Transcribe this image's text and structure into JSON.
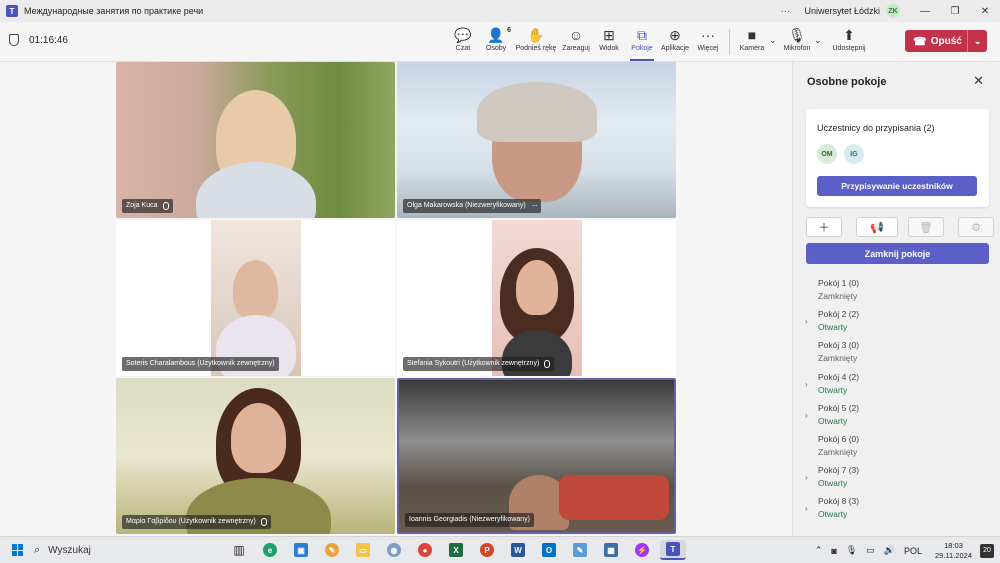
{
  "window": {
    "title": "Международные занятия по практике речи",
    "org": "Uniwersytet Łódzki",
    "user_initials": "ZK"
  },
  "meeting": {
    "timer": "01:16:46",
    "people_count": "6",
    "tools": [
      {
        "label": "Czat",
        "icon": "chat-icon"
      },
      {
        "label": "Osoby",
        "icon": "people-icon"
      },
      {
        "label": "Podnieś rękę",
        "icon": "raise-hand-icon"
      },
      {
        "label": "Zareaguj",
        "icon": "react-icon"
      },
      {
        "label": "Widok",
        "icon": "view-icon"
      },
      {
        "label": "Pokoje",
        "icon": "rooms-icon"
      },
      {
        "label": "Aplikacje",
        "icon": "apps-icon"
      },
      {
        "label": "Więcej",
        "icon": "more-icon"
      },
      {
        "label": "Kamera",
        "icon": "camera-icon"
      },
      {
        "label": "Mikrofon",
        "icon": "microphone-off-icon"
      },
      {
        "label": "Udostępnij",
        "icon": "share-icon"
      }
    ],
    "leave_label": "Opuść"
  },
  "participants": [
    {
      "name": "Zoja Kuca"
    },
    {
      "name": "Olga Makarowska (Niezweryfikowany)"
    },
    {
      "name": "Soteris Charalambous (Użytkownik zewnętrzny)"
    },
    {
      "name": "Stefania Sykoutri (Użytkownik zewnętrzny)"
    },
    {
      "name": "Μαρία Γαβρίδου (Użytkownik zewnętrzny)"
    },
    {
      "name": "Ioannis Georgiadis (Niezweryfikowany)"
    }
  ],
  "panel": {
    "title": "Osobne pokoje",
    "assign_title": "Uczestnicy do przypisania (2)",
    "avatars": [
      "OM",
      "IG"
    ],
    "assign_button": "Przypisywanie uczestników",
    "close_rooms_button": "Zamknij pokoje",
    "rooms": [
      {
        "name": "Pokój 1 (0)",
        "status": "Zamknięty"
      },
      {
        "name": "Pokój 2 (2)",
        "status": "Otwarty"
      },
      {
        "name": "Pokój 3 (0)",
        "status": "Zamknięty"
      },
      {
        "name": "Pokój 4 (2)",
        "status": "Otwarty"
      },
      {
        "name": "Pokój 5 (2)",
        "status": "Otwarty"
      },
      {
        "name": "Pokój 6 (0)",
        "status": "Zamknięty"
      },
      {
        "name": "Pokój 7 (3)",
        "status": "Otwarty"
      },
      {
        "name": "Pokój 8 (3)",
        "status": "Otwarty"
      }
    ]
  },
  "taskbar": {
    "search_label": "Wyszukaj",
    "language": "POL",
    "time": "18:03",
    "date": "29.11.2024",
    "notifications": "20"
  },
  "colors": {
    "accent": "#5b5fc7",
    "leave": "#c4314b",
    "open_status": "#237b4b"
  }
}
